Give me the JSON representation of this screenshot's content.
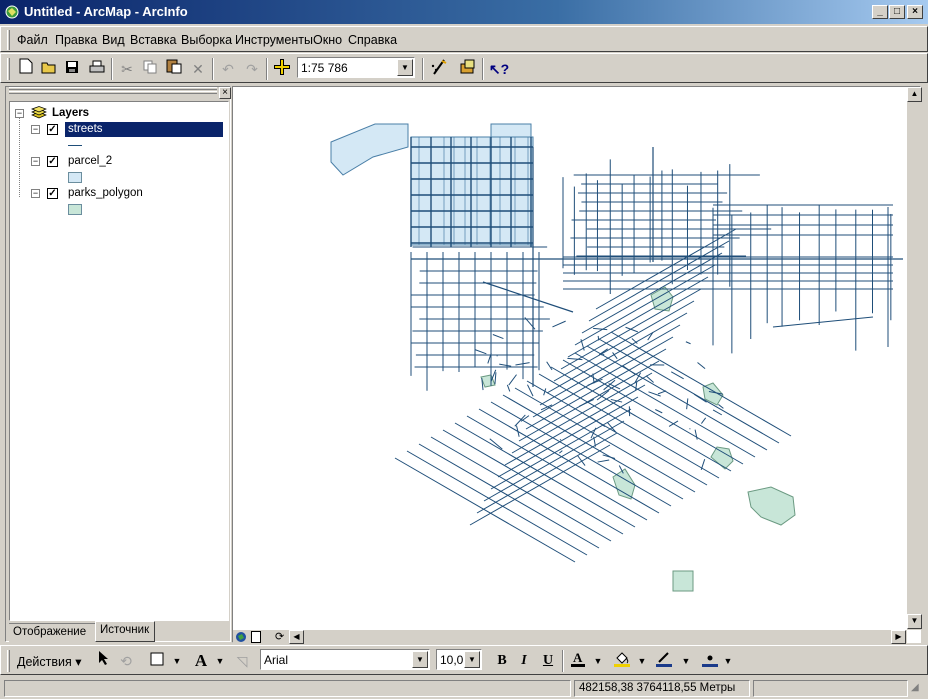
{
  "window": {
    "title": "Untitled - ArcMap - ArcInfo",
    "controls": {
      "minimize": "_",
      "maximize": "□",
      "close": "×"
    }
  },
  "menu": {
    "items": [
      "Файл",
      "Правка",
      "Вид",
      "Вставка",
      "Выборка",
      "Инструменты",
      "Окно",
      "Справка"
    ]
  },
  "toolbar": {
    "icons": [
      "new-document-icon",
      "open-folder-icon",
      "save-icon",
      "print-icon",
      "cut-icon",
      "copy-icon",
      "paste-icon",
      "delete-icon",
      "undo-icon",
      "redo-icon",
      "add-data-icon",
      "editor-icon",
      "arctoolbox-icon",
      "whats-this-icon"
    ],
    "scale": "1:75 786"
  },
  "toc": {
    "root_label": "Layers",
    "layers": [
      {
        "name": "streets",
        "checked": true,
        "selected": true,
        "symbol": "line",
        "color": "#1f4e79"
      },
      {
        "name": "parcel_2",
        "checked": true,
        "selected": false,
        "symbol": "fill",
        "color": "#d4e8f5"
      },
      {
        "name": "parks_polygon",
        "checked": true,
        "selected": false,
        "symbol": "fill",
        "color": "#c8e6d8"
      }
    ],
    "tabs": {
      "display": "Отображение",
      "source": "Источник"
    }
  },
  "map": {
    "street_color": "#1f4e79",
    "parcel_fill": "#d4e8f5",
    "parcel_stroke": "#4a7fa7",
    "park_fill": "#c8e6d8",
    "park_stroke": "#6b9a82"
  },
  "drawing": {
    "actions_label": "Действия",
    "font": "Arial",
    "font_size": "10,0",
    "bold": "B",
    "italic": "I",
    "underline": "U",
    "text_tool": "A"
  },
  "status": {
    "coordinates": "482158,38  3764118,55 Метры"
  }
}
